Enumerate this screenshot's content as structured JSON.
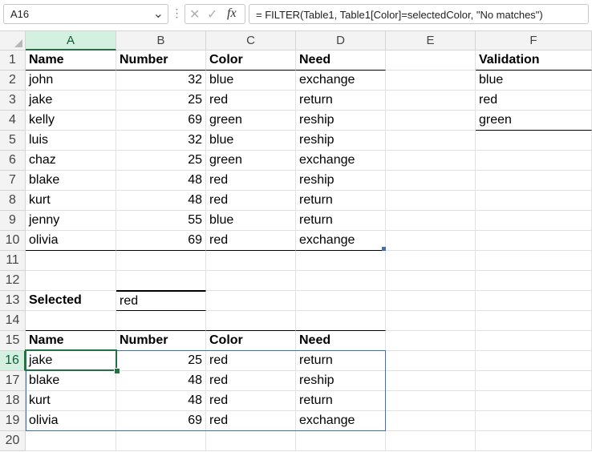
{
  "formula_bar": {
    "name_box": "A16",
    "dropdown_icon": "chevron-down-icon",
    "more_icon": "vertical-dots-icon",
    "cancel_symbol": "✕",
    "enter_symbol": "✓",
    "fx_symbol": "fx",
    "formula": "= FILTER(Table1, Table1[Color]=selectedColor, \"No matches\")"
  },
  "columns": [
    "A",
    "B",
    "C",
    "D",
    "E",
    "F"
  ],
  "rows": [
    "1",
    "2",
    "3",
    "4",
    "5",
    "6",
    "7",
    "8",
    "9",
    "10",
    "11",
    "12",
    "13",
    "14",
    "15",
    "16",
    "17",
    "18",
    "19",
    "20"
  ],
  "active_cell": "A16",
  "table1": {
    "headers": [
      "Name",
      "Number",
      "Color",
      "Need"
    ],
    "rows": [
      [
        "john",
        "32",
        "blue",
        "exchange"
      ],
      [
        "jake",
        "25",
        "red",
        "return"
      ],
      [
        "kelly",
        "69",
        "green",
        "reship"
      ],
      [
        "luis",
        "32",
        "blue",
        "reship"
      ],
      [
        "chaz",
        "25",
        "green",
        "exchange"
      ],
      [
        "blake",
        "48",
        "red",
        "reship"
      ],
      [
        "kurt",
        "48",
        "red",
        "return"
      ],
      [
        "jenny",
        "55",
        "blue",
        "return"
      ],
      [
        "olivia",
        "69",
        "red",
        "exchange"
      ]
    ]
  },
  "validation": {
    "header": "Validation",
    "items": [
      "blue",
      "red",
      "green"
    ]
  },
  "selected": {
    "label": "Selected",
    "value": "red"
  },
  "filter_result": {
    "headers": [
      "Name",
      "Number",
      "Color",
      "Need"
    ],
    "rows": [
      [
        "jake",
        "25",
        "red",
        "return"
      ],
      [
        "blake",
        "48",
        "red",
        "reship"
      ],
      [
        "kurt",
        "48",
        "red",
        "return"
      ],
      [
        "olivia",
        "69",
        "red",
        "exchange"
      ]
    ]
  },
  "colors": {
    "excel_green": "#217346",
    "spill_border": "#3a6fbf",
    "header_bg": "#f3f3f3",
    "active_header_bg": "#d3f0e0"
  }
}
